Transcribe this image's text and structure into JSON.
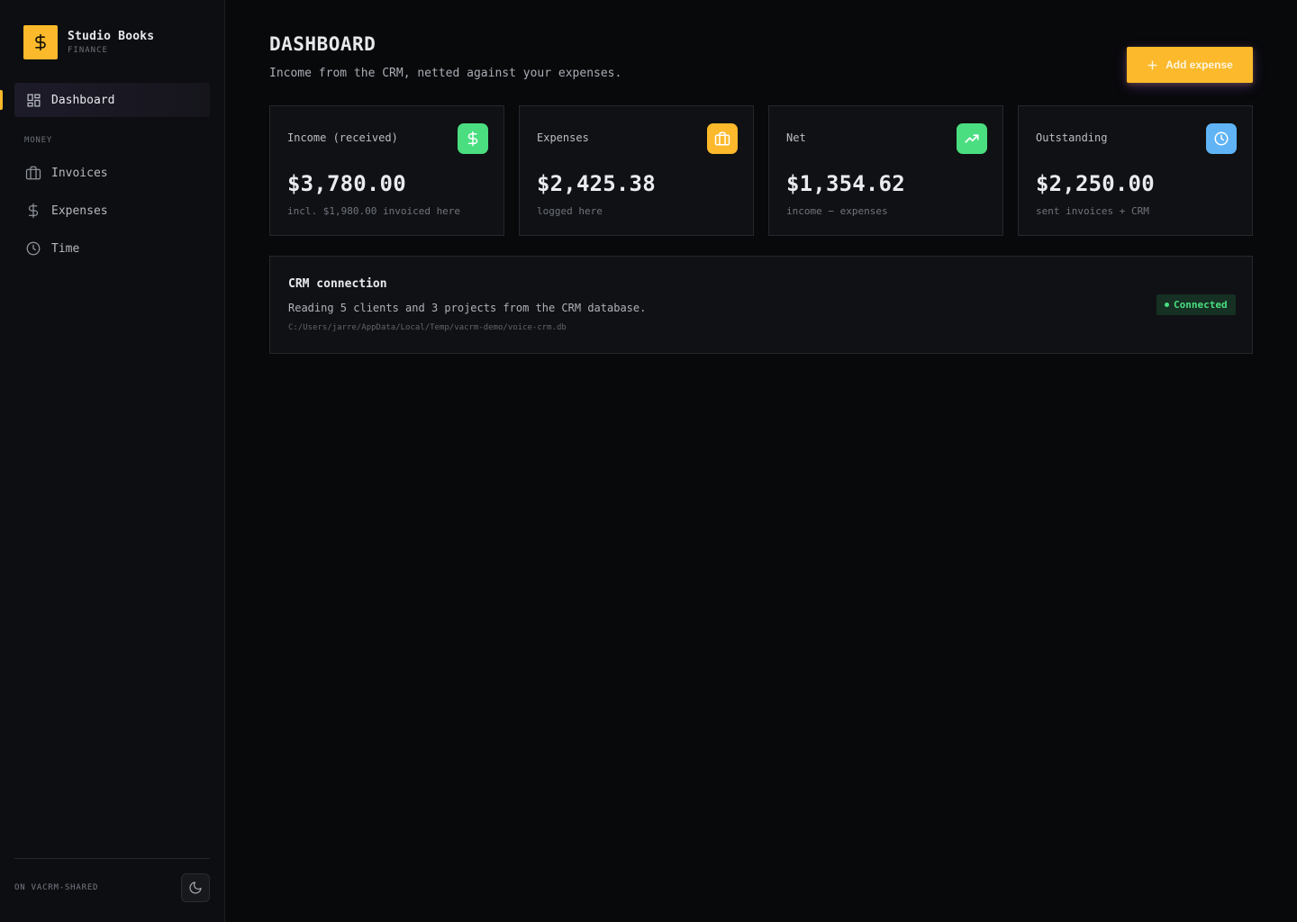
{
  "brand": {
    "title": "Studio Books",
    "subtitle": "FINANCE",
    "logo_icon": "dollar-icon",
    "accent_color": "#fbb92b"
  },
  "sidebar": {
    "items": [
      {
        "label": "Dashboard",
        "icon": "dashboard-grid-icon",
        "active": true
      }
    ],
    "section_label": "MONEY",
    "money_items": [
      {
        "label": "Invoices",
        "icon": "briefcase-icon"
      },
      {
        "label": "Expenses",
        "icon": "dollar-icon"
      },
      {
        "label": "Time",
        "icon": "clock-icon"
      }
    ],
    "footer_label": "ON VACRM-SHARED",
    "theme_toggle_icon": "moon-icon"
  },
  "header": {
    "title": "DASHBOARD",
    "subtitle": "Income from the CRM, netted against your expenses.",
    "add_button_label": "Add expense"
  },
  "stats": [
    {
      "label": "Income (received)",
      "value": "$3,780.00",
      "note": "incl. $1,980.00 invoiced here",
      "icon": "dollar-icon",
      "color": "#4ade80"
    },
    {
      "label": "Expenses",
      "value": "$2,425.38",
      "note": "logged here",
      "icon": "briefcase-icon",
      "color": "#fbb92b"
    },
    {
      "label": "Net",
      "value": "$1,354.62",
      "note": "income − expenses",
      "icon": "trending-up-icon",
      "color": "#4ade80"
    },
    {
      "label": "Outstanding",
      "value": "$2,250.00",
      "note": "sent invoices + CRM",
      "icon": "clock-icon",
      "color": "#60b4f6"
    }
  ],
  "crm": {
    "title": "CRM connection",
    "description": "Reading 5 clients and 3 projects from the CRM database.",
    "path": "C:/Users/jarre/AppData/Local/Temp/vacrm-demo/voice-crm.db",
    "status": "Connected",
    "status_color": "#4ade80"
  }
}
